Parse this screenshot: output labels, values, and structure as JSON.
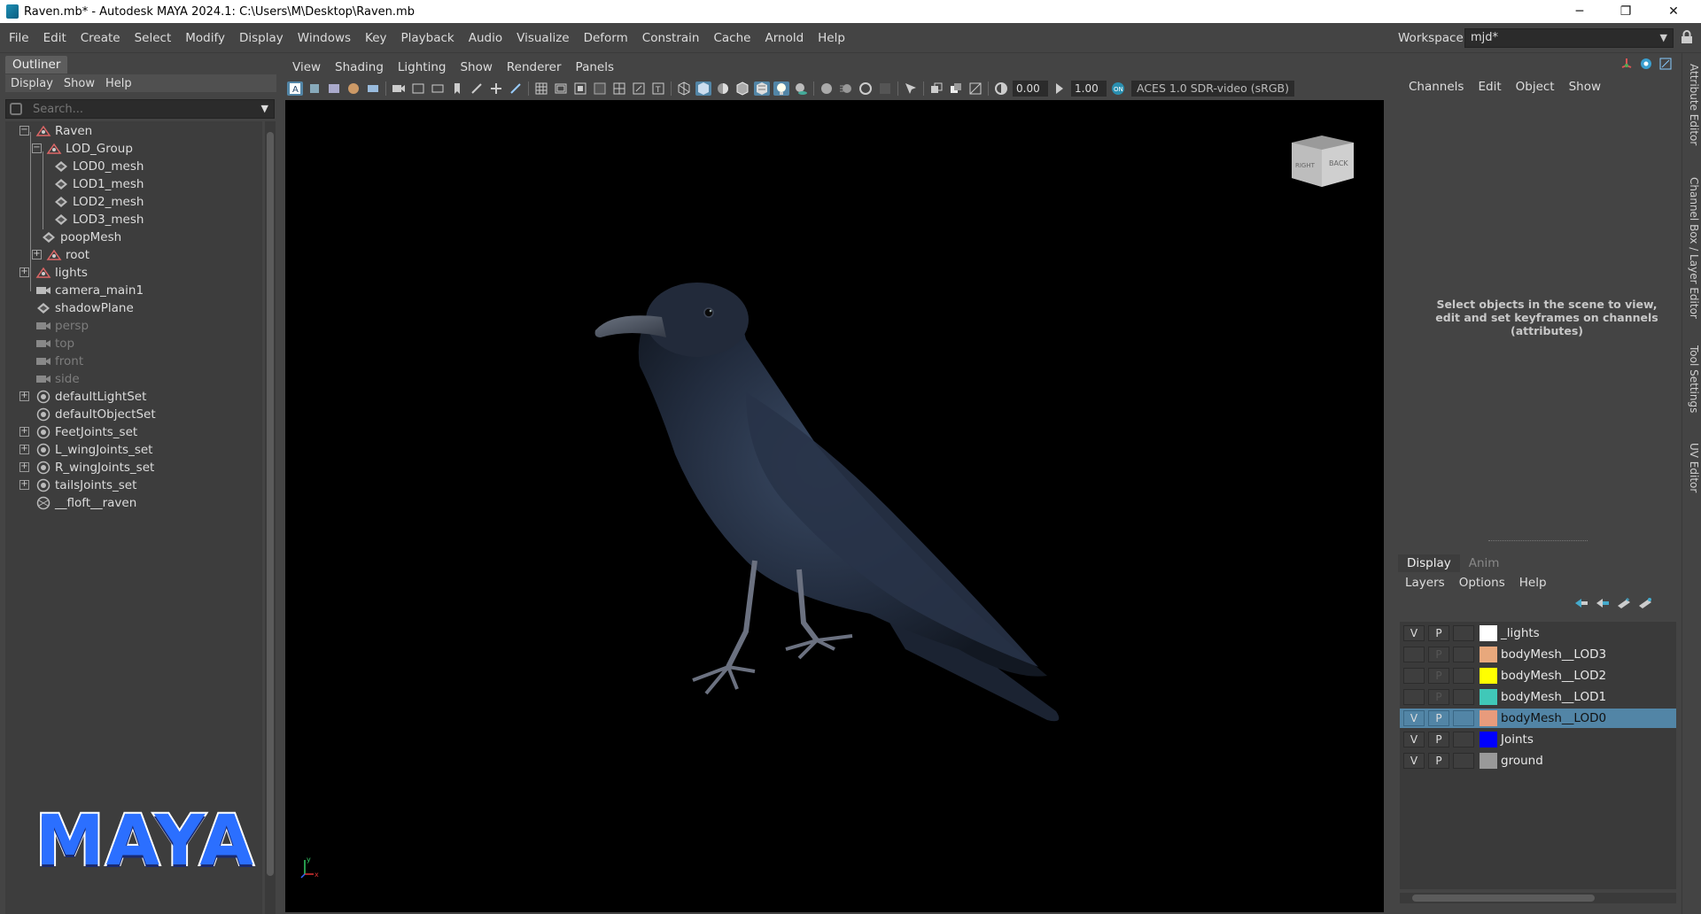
{
  "window": {
    "title": "Raven.mb* - Autodesk MAYA 2024.1: C:\\Users\\M\\Desktop\\Raven.mb",
    "minimize": "─",
    "restore": "❐",
    "close": "✕"
  },
  "main_menu": {
    "items": [
      "File",
      "Edit",
      "Create",
      "Select",
      "Modify",
      "Display",
      "Windows",
      "Key",
      "Playback",
      "Audio",
      "Visualize",
      "Deform",
      "Constrain",
      "Cache",
      "Arnold",
      "Help"
    ],
    "workspace_label": "Workspace:",
    "workspace_value": "mjd*"
  },
  "outliner": {
    "tab": "Outliner",
    "menu": [
      "Display",
      "Show",
      "Help"
    ],
    "search_placeholder": "Search...",
    "nodes": [
      {
        "label": "Raven",
        "icon": "group-icon"
      },
      {
        "label": "LOD_Group",
        "icon": "group-icon"
      },
      {
        "label": "LOD0_mesh",
        "icon": "mesh-icon"
      },
      {
        "label": "LOD1_mesh",
        "icon": "mesh-icon"
      },
      {
        "label": "LOD2_mesh",
        "icon": "mesh-icon"
      },
      {
        "label": "LOD3_mesh",
        "icon": "mesh-icon"
      },
      {
        "label": "poopMesh",
        "icon": "mesh-icon"
      },
      {
        "label": "root",
        "icon": "group-icon"
      },
      {
        "label": "lights",
        "icon": "group-icon"
      },
      {
        "label": "camera_main1",
        "icon": "camera-icon"
      },
      {
        "label": "shadowPlane",
        "icon": "mesh-icon"
      },
      {
        "label": "persp",
        "icon": "camera-icon"
      },
      {
        "label": "top",
        "icon": "camera-icon"
      },
      {
        "label": "front",
        "icon": "camera-icon"
      },
      {
        "label": "side",
        "icon": "camera-icon"
      },
      {
        "label": "defaultLightSet",
        "icon": "set-icon"
      },
      {
        "label": "defaultObjectSet",
        "icon": "set-icon"
      },
      {
        "label": "FeetJoints_set",
        "icon": "set-icon"
      },
      {
        "label": "L_wingJoints_set",
        "icon": "set-icon"
      },
      {
        "label": "R_wingJoints_set",
        "icon": "set-icon"
      },
      {
        "label": "tailsJoints_set",
        "icon": "set-icon"
      },
      {
        "label": "__floft__raven",
        "icon": "dag-icon"
      }
    ]
  },
  "logo_text": "MAYA",
  "viewport": {
    "menu": [
      "View",
      "Shading",
      "Lighting",
      "Show",
      "Renderer",
      "Panels"
    ],
    "exposure": "0.00",
    "gamma": "1.00",
    "color_space": "ACES 1.0 SDR-video (sRGB)",
    "viewcube_labels": [
      "RIGHT",
      "BACK"
    ],
    "axis_labels": [
      "y",
      "x"
    ]
  },
  "channel_box": {
    "menu": [
      "Channels",
      "Edit",
      "Object",
      "Show"
    ],
    "message": "Select objects in the scene to view, edit and set keyframes on channels (attributes)"
  },
  "layer_editor": {
    "tabs": [
      "Display",
      "Anim"
    ],
    "menu": [
      "Layers",
      "Options",
      "Help"
    ],
    "layers": [
      {
        "name": "_lights",
        "v": "V",
        "p": "P",
        "color": "#ffffff"
      },
      {
        "name": "bodyMesh__LOD3",
        "v": "",
        "p": "P",
        "color": "#e8a87c"
      },
      {
        "name": "bodyMesh__LOD2",
        "v": "",
        "p": "P",
        "color": "#ffff00"
      },
      {
        "name": "bodyMesh__LOD1",
        "v": "",
        "p": "P",
        "color": "#40c8b8"
      },
      {
        "name": "bodyMesh__LOD0",
        "v": "V",
        "p": "P",
        "color": "#e89b7c",
        "selected": true
      },
      {
        "name": "Joints",
        "v": "V",
        "p": "P",
        "color": "#0000ff"
      },
      {
        "name": "ground",
        "v": "V",
        "p": "P",
        "color": "#999999"
      }
    ]
  },
  "side_tabs": [
    "Attribute Editor",
    "Channel Box / Layer Editor",
    "Tool Settings",
    "UV Editor"
  ]
}
